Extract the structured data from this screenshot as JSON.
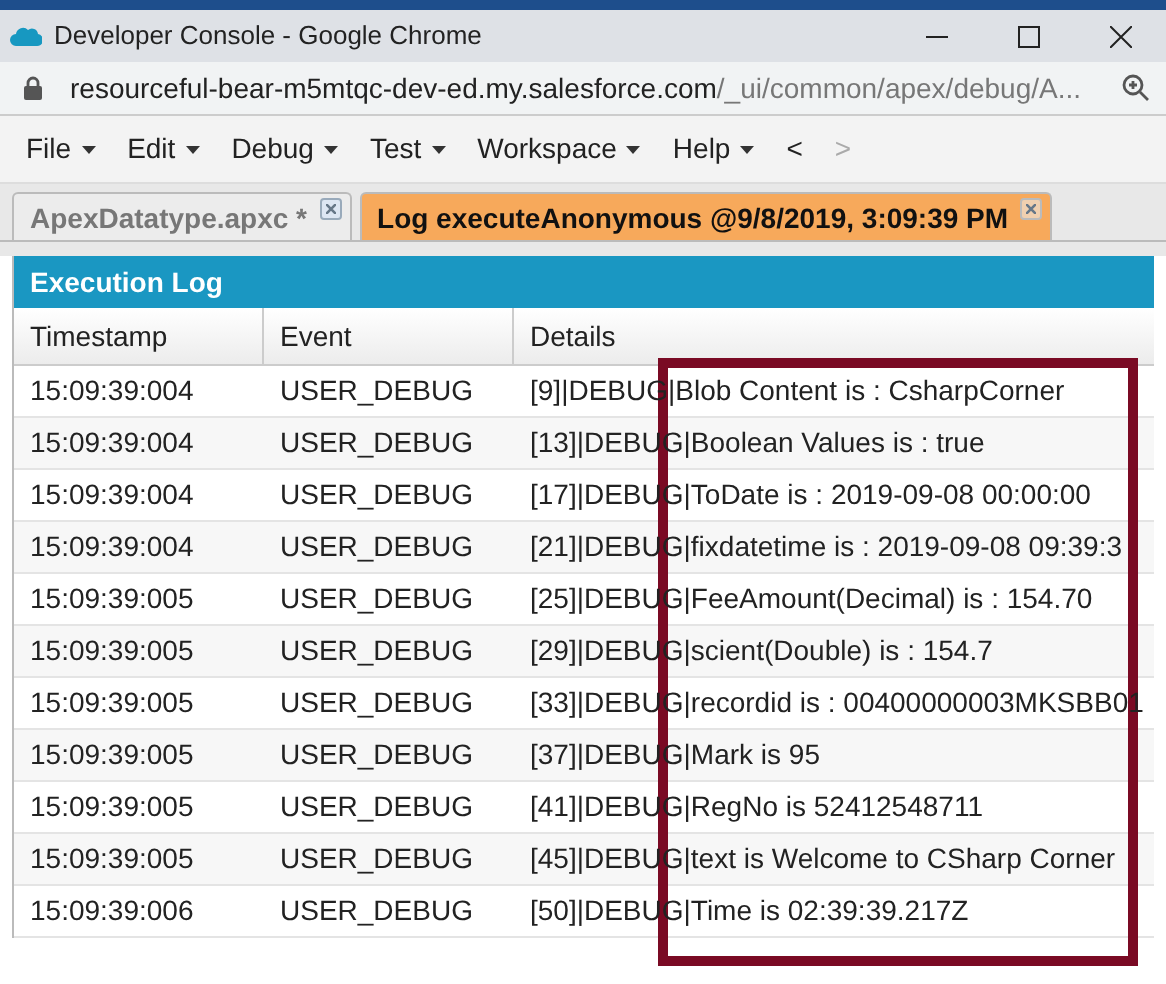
{
  "window": {
    "title": "Developer Console - Google Chrome"
  },
  "address_bar": {
    "url": "resourceful-bear-m5mtqc-dev-ed.my.salesforce.com/_ui/common/apex/debug/A..."
  },
  "menu": [
    {
      "label": "File",
      "dropdown": true
    },
    {
      "label": "Edit",
      "dropdown": true
    },
    {
      "label": "Debug",
      "dropdown": true
    },
    {
      "label": "Test",
      "dropdown": true
    },
    {
      "label": "Workspace",
      "dropdown": true
    },
    {
      "label": "Help",
      "dropdown": true
    },
    {
      "label": "<",
      "dropdown": false,
      "disabled": false
    },
    {
      "label": ">",
      "dropdown": false,
      "disabled": true
    }
  ],
  "tabs": [
    {
      "label": "ApexDatatype.apxc *",
      "selected": false
    },
    {
      "label": "Log executeAnonymous @9/8/2019, 3:09:39 PM",
      "selected": true
    }
  ],
  "panel": {
    "title": "Execution Log",
    "columns": [
      "Timestamp",
      "Event",
      "Details"
    ],
    "rows": [
      {
        "timestamp": "15:09:39:004",
        "event": "USER_DEBUG",
        "details": "[9]|DEBUG|Blob Content is : CsharpCorner"
      },
      {
        "timestamp": "15:09:39:004",
        "event": "USER_DEBUG",
        "details": "[13]|DEBUG|Boolean Values is : true"
      },
      {
        "timestamp": "15:09:39:004",
        "event": "USER_DEBUG",
        "details": "[17]|DEBUG|ToDate is : 2019-09-08 00:00:00"
      },
      {
        "timestamp": "15:09:39:004",
        "event": "USER_DEBUG",
        "details": "[21]|DEBUG|fixdatetime is : 2019-09-08 09:39:3"
      },
      {
        "timestamp": "15:09:39:005",
        "event": "USER_DEBUG",
        "details": "[25]|DEBUG|FeeAmount(Decimal) is : 154.70"
      },
      {
        "timestamp": "15:09:39:005",
        "event": "USER_DEBUG",
        "details": "[29]|DEBUG|scient(Double) is : 154.7"
      },
      {
        "timestamp": "15:09:39:005",
        "event": "USER_DEBUG",
        "details": "[33]|DEBUG|recordid is : 00400000003MKSBB01"
      },
      {
        "timestamp": "15:09:39:005",
        "event": "USER_DEBUG",
        "details": "[37]|DEBUG|Mark is 95"
      },
      {
        "timestamp": "15:09:39:005",
        "event": "USER_DEBUG",
        "details": "[41]|DEBUG|RegNo is 52412548711"
      },
      {
        "timestamp": "15:09:39:005",
        "event": "USER_DEBUG",
        "details": "[45]|DEBUG|text is Welcome to CSharp Corner"
      },
      {
        "timestamp": "15:09:39:006",
        "event": "USER_DEBUG",
        "details": "[50]|DEBUG|Time is 02:39:39.217Z"
      }
    ]
  }
}
